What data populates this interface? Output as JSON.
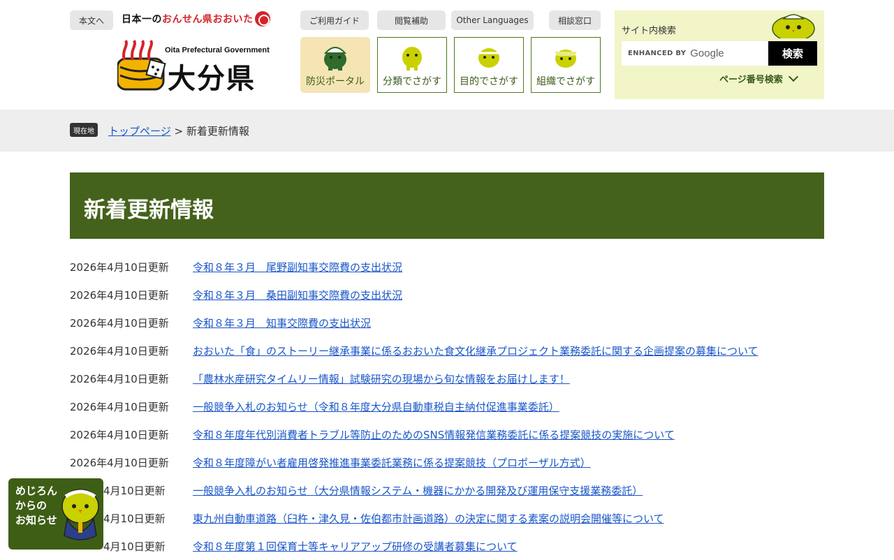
{
  "header": {
    "skip_label": "本文へ",
    "slogan": {
      "part1": "日本一の",
      "part2": "おんせん県おおいた"
    },
    "logo_en": "Oita Prefectural Government",
    "logo_ja": "大分県",
    "util_links": [
      "ご利用ガイド",
      "閲覧補助",
      "Other Languages",
      "相談窓口"
    ],
    "nav_boxes": [
      "防災ポータル",
      "分類でさがす",
      "目的でさがす",
      "組織でさがす"
    ]
  },
  "search": {
    "title": "サイト内検索",
    "enhanced_by": "ENHANCED BY",
    "google": "Google",
    "button_label": "検索",
    "page_number_search": "ページ番号検索"
  },
  "breadcrumb": {
    "here_label": "現在地",
    "top_link": "トップページ",
    "separator": " > ",
    "current": "新着更新情報"
  },
  "page_title": "新着更新情報",
  "news": [
    {
      "date": "2026年4月10日更新",
      "title": "令和８年３月　尾野副知事交際費の支出状況"
    },
    {
      "date": "2026年4月10日更新",
      "title": "令和８年３月　桑田副知事交際費の支出状況"
    },
    {
      "date": "2026年4月10日更新",
      "title": "令和８年３月　知事交際費の支出状況"
    },
    {
      "date": "2026年4月10日更新",
      "title": "おおいた「食」のストーリー継承事業に係るおおいた食文化継承プロジェクト業務委託に関する企画提案の募集について"
    },
    {
      "date": "2026年4月10日更新",
      "title": "「農林水産研究タイムリー情報」試験研究の現場から旬な情報をお届けします！"
    },
    {
      "date": "2026年4月10日更新",
      "title": "一般競争入札のお知らせ（令和８年度大分県自動車税自主納付促進事業委託）"
    },
    {
      "date": "2026年4月10日更新",
      "title": "令和８年度年代別消費者トラブル等防止のためのSNS情報発信業務委託に係る提案競技の実施について"
    },
    {
      "date": "2026年4月10日更新",
      "title": "令和８年度障がい者雇用啓発推進事業委託業務に係る提案競技（プロポーザル方式）"
    },
    {
      "date": "4月10日更新",
      "title": "一般競争入札のお知らせ（大分県情報システム・機器にかかる開発及び運用保守支援業務委託）"
    },
    {
      "date": "4月10日更新",
      "title": "東九州自動車道路（臼杵・津久見・佐伯都市計画道路）の決定に関する素案の説明会開催等について"
    },
    {
      "date": "4月10日更新",
      "title": "令和８年度第１回保育士等キャリアアップ研修の受講者募集について"
    }
  ],
  "mejiron": {
    "line1": "めじろん",
    "line2": "からの",
    "line3": "お知らせ"
  },
  "colors": {
    "brand_green": "#44621b",
    "link_blue": "#1a56c8",
    "search_panel": "#f1f5c8",
    "disaster_bg": "#f5e5b4"
  }
}
